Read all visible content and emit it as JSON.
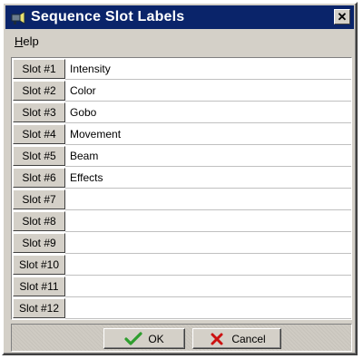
{
  "window": {
    "title": "Sequence Slot Labels"
  },
  "menu": {
    "items": [
      "Help"
    ]
  },
  "slots": [
    {
      "slot": "Slot #1",
      "label": "Intensity"
    },
    {
      "slot": "Slot #2",
      "label": "Color"
    },
    {
      "slot": "Slot #3",
      "label": "Gobo"
    },
    {
      "slot": "Slot #4",
      "label": "Movement"
    },
    {
      "slot": "Slot #5",
      "label": "Beam"
    },
    {
      "slot": "Slot #6",
      "label": "Effects"
    },
    {
      "slot": "Slot #7",
      "label": ""
    },
    {
      "slot": "Slot #8",
      "label": ""
    },
    {
      "slot": "Slot #9",
      "label": ""
    },
    {
      "slot": "Slot #10",
      "label": ""
    },
    {
      "slot": "Slot #11",
      "label": ""
    },
    {
      "slot": "Slot #12",
      "label": ""
    }
  ],
  "buttons": {
    "ok": "OK",
    "cancel": "Cancel"
  },
  "icons": {
    "app": "spotlight-icon",
    "close": "close-icon",
    "ok": "checkmark-icon",
    "cancel": "cross-icon"
  },
  "colors": {
    "titlebar": "#0a246a",
    "face": "#d4d0c8",
    "ok_check": "#2e9e2e",
    "cancel_x": "#cc1111"
  }
}
